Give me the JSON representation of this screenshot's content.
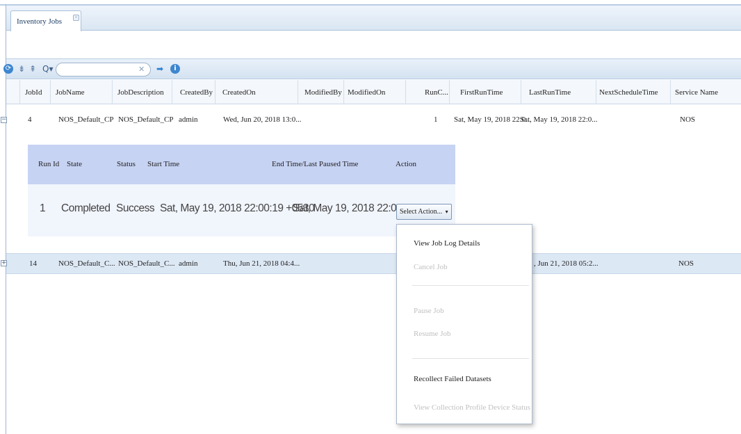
{
  "tab": {
    "label": "Inventory Jobs",
    "close": "×"
  },
  "toolbar": {
    "refresh_icon": "⟳",
    "expand_icon": "⇟",
    "collapse_icon": "⇞",
    "search_icon": "Q▾",
    "search_value": "",
    "search_placeholder": "",
    "clear_icon": "✕",
    "go_icon": "➡",
    "info_icon": "i"
  },
  "columns": {
    "jobid": "JobId",
    "jobname": "JobName",
    "jobdesc": "JobDescription",
    "createdby": "CreatedBy",
    "createdon": "CreatedOn",
    "modifiedby": "ModifiedBy",
    "modifiedon": "ModifiedOn",
    "runc": "RunC...",
    "firstrun": "FirstRunTime",
    "lastrun": "LastRunTime",
    "nextsched": "NextScheduleTime",
    "service": "Service Name"
  },
  "rows": [
    {
      "toggle": "−",
      "jobid": "4",
      "jobname": "NOS_Default_CP",
      "jobdesc": "NOS_Default_CP",
      "createdby": "admin",
      "createdon": "Wed, Jun 20, 2018 13:0...",
      "modifiedby": "",
      "modifiedon": "",
      "runc": "1",
      "firstrun": "Sat, May 19, 2018 22:0...",
      "lastrun": "Sat, May 19, 2018 22:0...",
      "nextsched": "",
      "service": "NOS"
    },
    {
      "toggle": "+",
      "jobid": "14",
      "jobname": "NOS_Default_C...",
      "jobdesc": "NOS_Default_C...",
      "createdby": "admin",
      "createdon": "Thu, Jun 21, 2018 04:4...",
      "lastrun_partial": ", Jun 21, 2018 05:2...",
      "service": "NOS"
    }
  ],
  "sub_grid": {
    "headers": {
      "runid": "Run Id",
      "state": "State",
      "status": "Status",
      "start": "Start Time",
      "end": "End Time/Last Paused Time",
      "action": "Action"
    },
    "row": {
      "runid": "1",
      "state": "Completed",
      "status": "Success",
      "start": "Sat, May 19, 2018 22:00:19 +0530",
      "end": "Sat, May 19, 2018 22:00:45 +0530",
      "action_label": "Select Action...",
      "action_arrow": "▾"
    }
  },
  "action_menu": [
    {
      "label": "View Job Log Details",
      "enabled": true
    },
    {
      "label": "Cancel Job",
      "enabled": false
    },
    {
      "label": "Pause Job",
      "enabled": false
    },
    {
      "label": "Resume Job",
      "enabled": false
    },
    {
      "label": "Recollect Failed Datasets",
      "enabled": true
    },
    {
      "label": "View Collection Profile Device Status",
      "enabled": false
    }
  ]
}
